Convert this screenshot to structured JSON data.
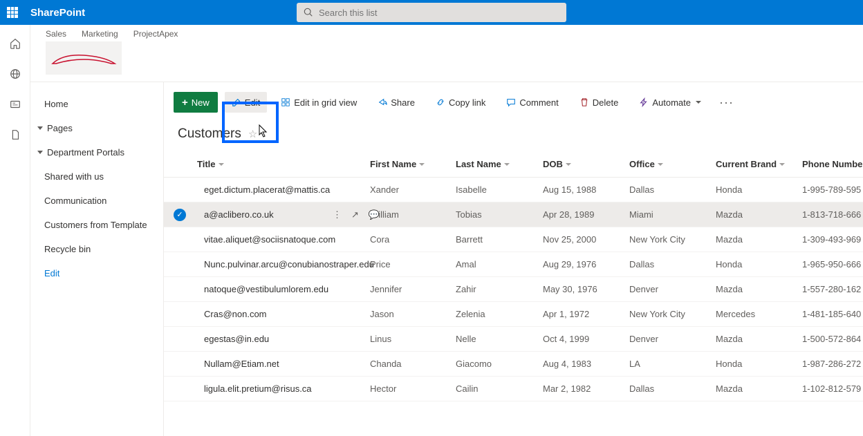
{
  "brand": "SharePoint",
  "search": {
    "placeholder": "Search this list"
  },
  "site_links": [
    "Sales",
    "Marketing",
    "ProjectApex"
  ],
  "nav": {
    "items": [
      {
        "label": "Home",
        "chev": false
      },
      {
        "label": "Pages",
        "chev": true
      },
      {
        "label": "Department Portals",
        "chev": true
      },
      {
        "label": "Shared with us",
        "chev": false
      },
      {
        "label": "Communication",
        "chev": false
      },
      {
        "label": "Customers from Template",
        "chev": false
      },
      {
        "label": "Recycle bin",
        "chev": false
      },
      {
        "label": "Edit",
        "chev": false,
        "edit": true
      }
    ]
  },
  "cmd": {
    "new": "New",
    "edit": "Edit",
    "grid": "Edit in grid view",
    "share": "Share",
    "copy": "Copy link",
    "comment": "Comment",
    "delete": "Delete",
    "automate": "Automate"
  },
  "list": {
    "title": "Customers",
    "columns": [
      "Title",
      "First Name",
      "Last Name",
      "DOB",
      "Office",
      "Current Brand",
      "Phone Number"
    ],
    "rows": [
      {
        "title": "eget.dictum.placerat@mattis.ca",
        "fname": "Xander",
        "lname": "Isabelle",
        "dob": "Aug 15, 1988",
        "office": "Dallas",
        "brand": "Honda",
        "phone": "1-995-789-595"
      },
      {
        "title": "a@aclibero.co.uk",
        "fname": "William",
        "lname": "Tobias",
        "dob": "Apr 28, 1989",
        "office": "Miami",
        "brand": "Mazda",
        "phone": "1-813-718-666",
        "selected": true
      },
      {
        "title": "vitae.aliquet@sociisnatoque.com",
        "fname": "Cora",
        "lname": "Barrett",
        "dob": "Nov 25, 2000",
        "office": "New York City",
        "brand": "Mazda",
        "phone": "1-309-493-969"
      },
      {
        "title": "Nunc.pulvinar.arcu@conubianostraper.edu",
        "fname": "Price",
        "lname": "Amal",
        "dob": "Aug 29, 1976",
        "office": "Dallas",
        "brand": "Honda",
        "phone": "1-965-950-666"
      },
      {
        "title": "natoque@vestibulumlorem.edu",
        "fname": "Jennifer",
        "lname": "Zahir",
        "dob": "May 30, 1976",
        "office": "Denver",
        "brand": "Mazda",
        "phone": "1-557-280-162"
      },
      {
        "title": "Cras@non.com",
        "fname": "Jason",
        "lname": "Zelenia",
        "dob": "Apr 1, 1972",
        "office": "New York City",
        "brand": "Mercedes",
        "phone": "1-481-185-640"
      },
      {
        "title": "egestas@in.edu",
        "fname": "Linus",
        "lname": "Nelle",
        "dob": "Oct 4, 1999",
        "office": "Denver",
        "brand": "Mazda",
        "phone": "1-500-572-864"
      },
      {
        "title": "Nullam@Etiam.net",
        "fname": "Chanda",
        "lname": "Giacomo",
        "dob": "Aug 4, 1983",
        "office": "LA",
        "brand": "Honda",
        "phone": "1-987-286-272"
      },
      {
        "title": "ligula.elit.pretium@risus.ca",
        "fname": "Hector",
        "lname": "Cailin",
        "dob": "Mar 2, 1982",
        "office": "Dallas",
        "brand": "Mazda",
        "phone": "1-102-812-579"
      }
    ]
  }
}
